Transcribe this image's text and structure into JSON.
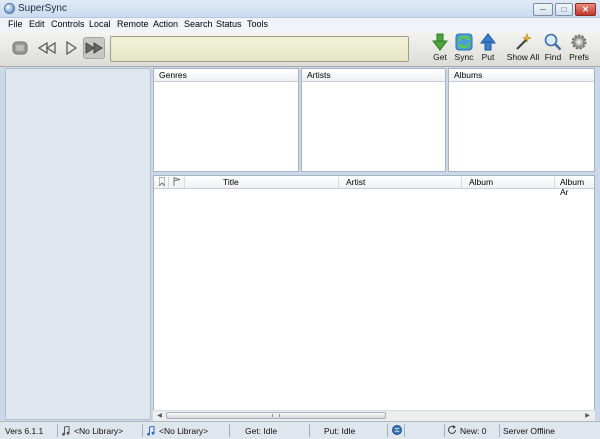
{
  "window": {
    "title": "SuperSync",
    "min_glyph": "─",
    "max_glyph": "□",
    "close_glyph": "✕"
  },
  "menu": [
    "File",
    "Edit",
    "Controls",
    "Local",
    "Remote",
    "Action",
    "Search",
    "Status",
    "Tools"
  ],
  "toolbar": {
    "actions": {
      "get": "Get",
      "sync": "Sync",
      "put": "Put",
      "show_all": "Show All",
      "find": "Find",
      "prefs": "Prefs"
    }
  },
  "browser": {
    "genres": "Genres",
    "artists": "Artists",
    "albums": "Albums"
  },
  "tracks": {
    "columns": [
      "Title",
      "Artist",
      "Album",
      "Album Ar"
    ]
  },
  "status": {
    "version": "Vers 6.1.1",
    "local_library": "<No Library>",
    "remote_library": "<No Library>",
    "get": "Get: Idle",
    "put": "Put: Idle",
    "new": "New: 0",
    "server": "Server Offline"
  },
  "colors": {
    "accent_green": "#3f9a2c",
    "accent_blue": "#2f6fc2",
    "lcd": "#e9ebcc"
  }
}
